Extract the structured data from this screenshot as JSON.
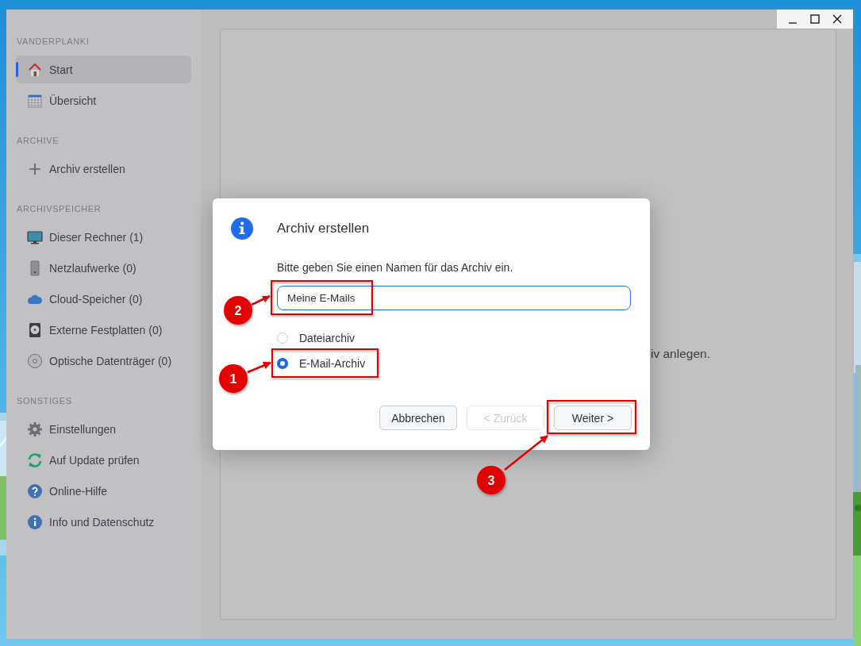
{
  "window_controls": [
    {
      "kind": "minimize"
    },
    {
      "kind": "maximize"
    },
    {
      "kind": "close"
    }
  ],
  "sidebar": {
    "sections": [
      {
        "title": "VANDERPLANKI",
        "items": [
          {
            "label": "Start",
            "selected": true
          },
          {
            "label": "Übersicht",
            "selected": false
          }
        ]
      },
      {
        "title": "ARCHIVE",
        "items": [
          {
            "label": "Archiv erstellen",
            "selected": false
          }
        ]
      },
      {
        "title": "ARCHIVSPEICHER",
        "items": [
          {
            "label": "Dieser Rechner (1)",
            "selected": false
          },
          {
            "label": "Netzlaufwerke (0)",
            "selected": false
          },
          {
            "label": "Cloud-Speicher (0)",
            "selected": false
          },
          {
            "label": "Externe Festplatten (0)",
            "selected": false
          },
          {
            "label": "Optische Datenträger (0)",
            "selected": false
          }
        ]
      },
      {
        "title": "SONSTIGES",
        "items": [
          {
            "label": "Einstellungen",
            "selected": false
          },
          {
            "label": "Auf Update prüfen",
            "selected": false
          },
          {
            "label": "Online-Hilfe",
            "selected": false
          },
          {
            "label": "Info und Datenschutz",
            "selected": false
          }
        ]
      }
    ]
  },
  "main": {
    "text": "iv anlegen."
  },
  "dialog": {
    "title": "Archiv erstellen",
    "prompt": "Bitte geben Sie einen Namen für das Archiv ein.",
    "name_field": {
      "value": "Meine E-Mails"
    },
    "options": [
      {
        "label": "Dateiarchiv",
        "selected": false
      },
      {
        "label": "E-Mail-Archiv",
        "selected": true
      }
    ],
    "buttons": [
      {
        "label": "Abbrechen",
        "disabled": false
      },
      {
        "label": "< Zurück",
        "disabled": true
      },
      {
        "label": "Weiter >",
        "disabled": false
      }
    ]
  },
  "annotations": [
    {
      "number": "1"
    },
    {
      "number": "2"
    },
    {
      "number": "3"
    }
  ]
}
